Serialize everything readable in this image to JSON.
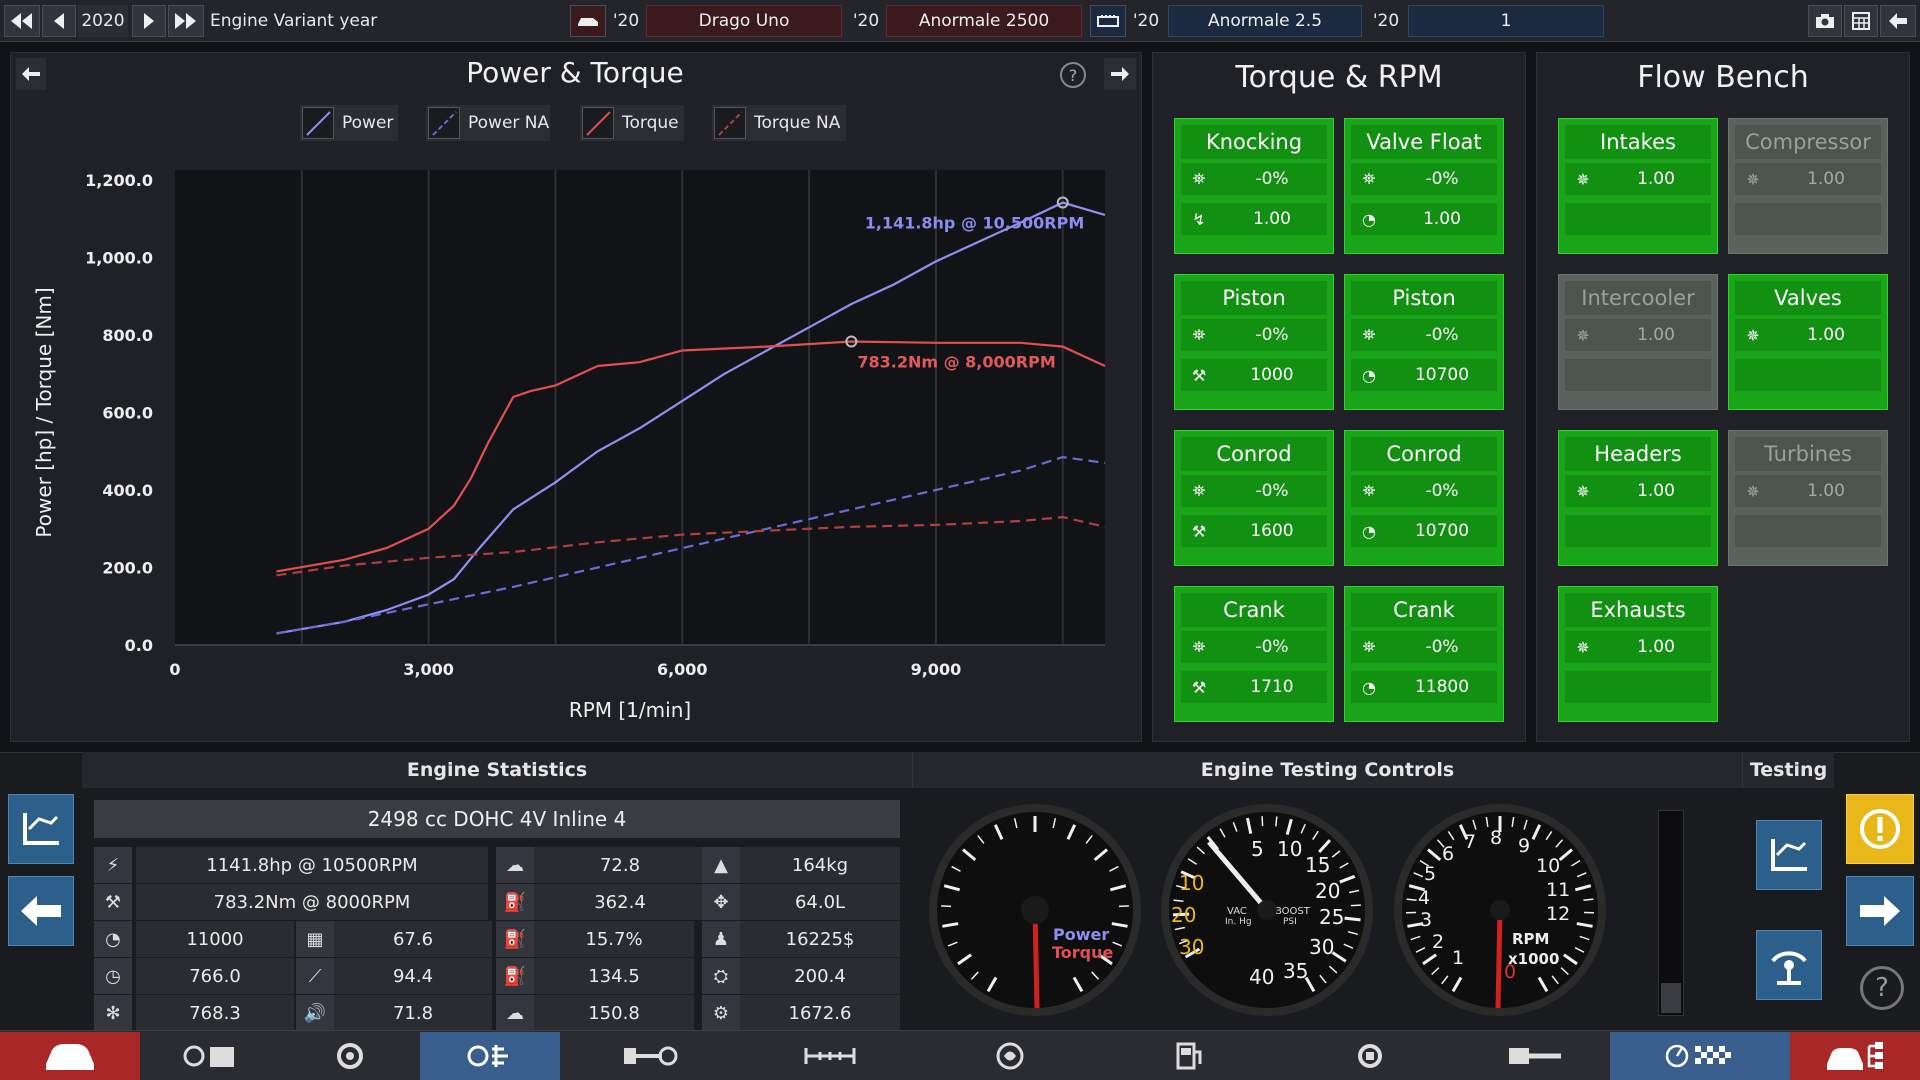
{
  "topbar": {
    "year": "2020",
    "variant_label": "Engine Variant year",
    "car1_year": "'20",
    "car1_name": "Drago Uno",
    "car2_year": "'20",
    "car2_name": "Anormale 2500",
    "engine_year": "'20",
    "engine_name": "Anormale 2.5",
    "variant_year": "'20",
    "variant_name": "1"
  },
  "power_torque": {
    "title": "Power & Torque",
    "help": "?",
    "legend": [
      "Power",
      "Power NA",
      "Torque",
      "Torque NA"
    ]
  },
  "chart_data": {
    "type": "line",
    "xlabel": "RPM [1/min]",
    "ylabel": "Power [hp] / Torque [Nm]",
    "xlim": [
      0,
      11000
    ],
    "ylim": [
      0,
      1200
    ],
    "x_ticks": [
      "0",
      "3,000",
      "6,000",
      "9,000"
    ],
    "x_tick_values": [
      0,
      3000,
      6000,
      9000
    ],
    "y_ticks": [
      "0.0",
      "200.0",
      "400.0",
      "600.0",
      "800.0",
      "1,000.0",
      "1,200.0"
    ],
    "y_tick_values": [
      0,
      200,
      400,
      600,
      800,
      1000,
      1200
    ],
    "grid": true,
    "series": [
      {
        "name": "Power",
        "color": "#8f8ff0",
        "dashed": false,
        "x": [
          1200,
          2000,
          2500,
          3000,
          3300,
          3600,
          4000,
          4500,
          5000,
          5500,
          6000,
          6500,
          7000,
          7500,
          8000,
          8500,
          9000,
          9500,
          10000,
          10500,
          11000
        ],
        "y": [
          30,
          60,
          90,
          130,
          170,
          250,
          350,
          420,
          500,
          560,
          630,
          700,
          760,
          820,
          880,
          930,
          990,
          1040,
          1090,
          1141.8,
          1110
        ]
      },
      {
        "name": "Power NA",
        "color": "#6a6ad8",
        "dashed": true,
        "x": [
          1200,
          2000,
          3000,
          4000,
          5000,
          6000,
          7000,
          8000,
          9000,
          10000,
          10500,
          11000
        ],
        "y": [
          30,
          60,
          105,
          150,
          200,
          250,
          300,
          350,
          400,
          450,
          485,
          470
        ]
      },
      {
        "name": "Torque",
        "color": "#e05050",
        "dashed": false,
        "x": [
          1200,
          2000,
          2500,
          3000,
          3300,
          3500,
          3700,
          3900,
          4000,
          4200,
          4500,
          5000,
          5500,
          6000,
          7000,
          8000,
          9000,
          10000,
          10500,
          11000
        ],
        "y": [
          190,
          220,
          250,
          300,
          360,
          430,
          520,
          600,
          640,
          655,
          670,
          720,
          730,
          760,
          770,
          783.2,
          780,
          780,
          770,
          720
        ]
      },
      {
        "name": "Torque NA",
        "color": "#b04040",
        "dashed": true,
        "x": [
          1200,
          2000,
          3000,
          4000,
          5000,
          6000,
          7000,
          8000,
          9000,
          10000,
          10500,
          11000
        ],
        "y": [
          180,
          205,
          225,
          240,
          265,
          285,
          295,
          305,
          310,
          320,
          330,
          305
        ]
      }
    ],
    "annotations": [
      {
        "text": "1,141.8hp @ 10,500RPM",
        "x": 10500,
        "y": 1141.8,
        "color": "#8b8bf0"
      },
      {
        "text": "783.2Nm @ 8,000RPM",
        "x": 8000,
        "y": 783.2,
        "color": "#e05a5a"
      }
    ]
  },
  "torque_rpm": {
    "title": "Torque & RPM",
    "boxes": [
      {
        "title": "Knocking",
        "v1": "-0%",
        "v2": "1.00",
        "i1": "⛯",
        "i2": "↯"
      },
      {
        "title": "Valve Float",
        "v1": "-0%",
        "v2": "1.00",
        "i1": "⛯",
        "i2": "◔"
      },
      {
        "title": "Piston",
        "v1": "-0%",
        "v2": "1000",
        "i1": "⛯",
        "i2": "⚒"
      },
      {
        "title": "Piston",
        "v1": "-0%",
        "v2": "10700",
        "i1": "⛯",
        "i2": "◔"
      },
      {
        "title": "Conrod",
        "v1": "-0%",
        "v2": "1600",
        "i1": "⛯",
        "i2": "⚒"
      },
      {
        "title": "Conrod",
        "v1": "-0%",
        "v2": "10700",
        "i1": "⛯",
        "i2": "◔"
      },
      {
        "title": "Crank",
        "v1": "-0%",
        "v2": "1710",
        "i1": "⛯",
        "i2": "⚒"
      },
      {
        "title": "Crank",
        "v1": "-0%",
        "v2": "11800",
        "i1": "⛯",
        "i2": "◔"
      }
    ]
  },
  "flow_bench": {
    "title": "Flow Bench",
    "boxes": [
      {
        "title": "Intakes",
        "v1": "1.00",
        "enabled": true
      },
      {
        "title": "Compressor",
        "v1": "1.00",
        "enabled": false
      },
      {
        "title": "Intercooler",
        "v1": "1.00",
        "enabled": false
      },
      {
        "title": "Valves",
        "v1": "1.00",
        "enabled": true
      },
      {
        "title": "Headers",
        "v1": "1.00",
        "enabled": true
      },
      {
        "title": "Turbines",
        "v1": "1.00",
        "enabled": false
      },
      {
        "title": "Exhausts",
        "v1": "1.00",
        "enabled": true
      }
    ]
  },
  "stats": {
    "title": "Engine Statistics",
    "engine_desc": "2498 cc DOHC 4V  Inline 4",
    "rows": [
      [
        "1141.8hp @ 10500RPM",
        "72.8",
        "164kg"
      ],
      [
        "783.2Nm @ 8000RPM",
        "362.4",
        "64.0L"
      ],
      [
        "11000",
        "67.6",
        "15.7%",
        "16225$"
      ],
      [
        "766.0",
        "94.4",
        "134.5",
        "200.4"
      ],
      [
        "768.3",
        "71.8",
        "150.8",
        "1672.6"
      ]
    ]
  },
  "testing_controls": {
    "title": "Engine Testing Controls",
    "gauge1_label1": "Power",
    "gauge1_label2": "Torque",
    "gauge2_labels": [
      "10",
      "20",
      "30",
      "5",
      "10",
      "15",
      "20",
      "25",
      "30",
      "35",
      "40"
    ],
    "gauge2_vac": "VAC",
    "gauge2_vac_unit": "In. Hg",
    "gauge2_boost": "BOOST",
    "gauge2_boost_unit": "PSI",
    "gauge3_labels": [
      "1",
      "2",
      "3",
      "4",
      "5",
      "6",
      "7",
      "8",
      "9",
      "10",
      "11",
      "12",
      "0"
    ],
    "gauge3_rpm": "RPM",
    "gauge3_x": "x1000"
  },
  "testing": {
    "title": "Testing"
  },
  "colors": {
    "accent": "#1aa41a",
    "power": "#8f8ff0",
    "torque": "#e05050",
    "blue_btn": "#2c5f8a",
    "warn": "#e8b81a"
  }
}
